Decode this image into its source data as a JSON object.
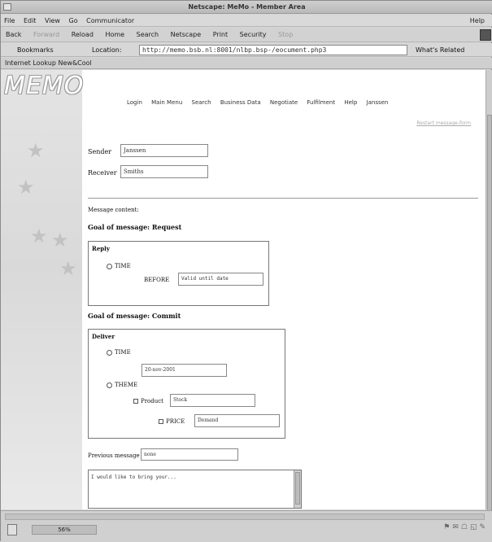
{
  "window": {
    "title": "Netscape: MeMo - Member Area"
  },
  "menu": {
    "items": [
      "File",
      "Edit",
      "View",
      "Go",
      "Communicator"
    ],
    "help": "Help"
  },
  "toolbar": {
    "buttons": [
      "Back",
      "Forward",
      "Reload",
      "Home",
      "Search",
      "Netscape",
      "Print",
      "Security",
      "Stop"
    ]
  },
  "location": {
    "bookmarks": "Bookmarks",
    "label": "Location:",
    "url": "http://memo.bsb.nl:8001/nlbp.bsp-/eocument.php3",
    "whats_related": "What's Related"
  },
  "personal": {
    "label": "Internet Lookup  New&Cool"
  },
  "page": {
    "logo": "MEMO",
    "nav": [
      "Login",
      "Main Menu",
      "Search",
      "Business Data",
      "Negotiate",
      "Fulfilment",
      "Help",
      "Janssen"
    ],
    "top_right_link": "Restart message-form",
    "sender_label": "Sender",
    "sender_value": "Janssen",
    "receiver_label": "Receiver",
    "receiver_value": "Smiths",
    "message_content_label": "Message content:",
    "goal1": "Goal of message: Request",
    "reply_title": "Reply",
    "time_label": "TIME",
    "before_label": "BEFORE",
    "before_value": "Valid until date",
    "goal2": "Goal of message: Commit",
    "deliver_title": "Deliver",
    "deliver_time_label": "TIME",
    "deliver_date": "20-nov-2001",
    "theme_label": "THEME",
    "product_label": "Product",
    "product_value": "Stock",
    "price_label": "PRICE",
    "price_value": "Demand",
    "previous_label": "Previous message",
    "previous_value": "none",
    "textarea_text": "I would like to bring your..."
  },
  "status": {
    "percent": "56%"
  }
}
